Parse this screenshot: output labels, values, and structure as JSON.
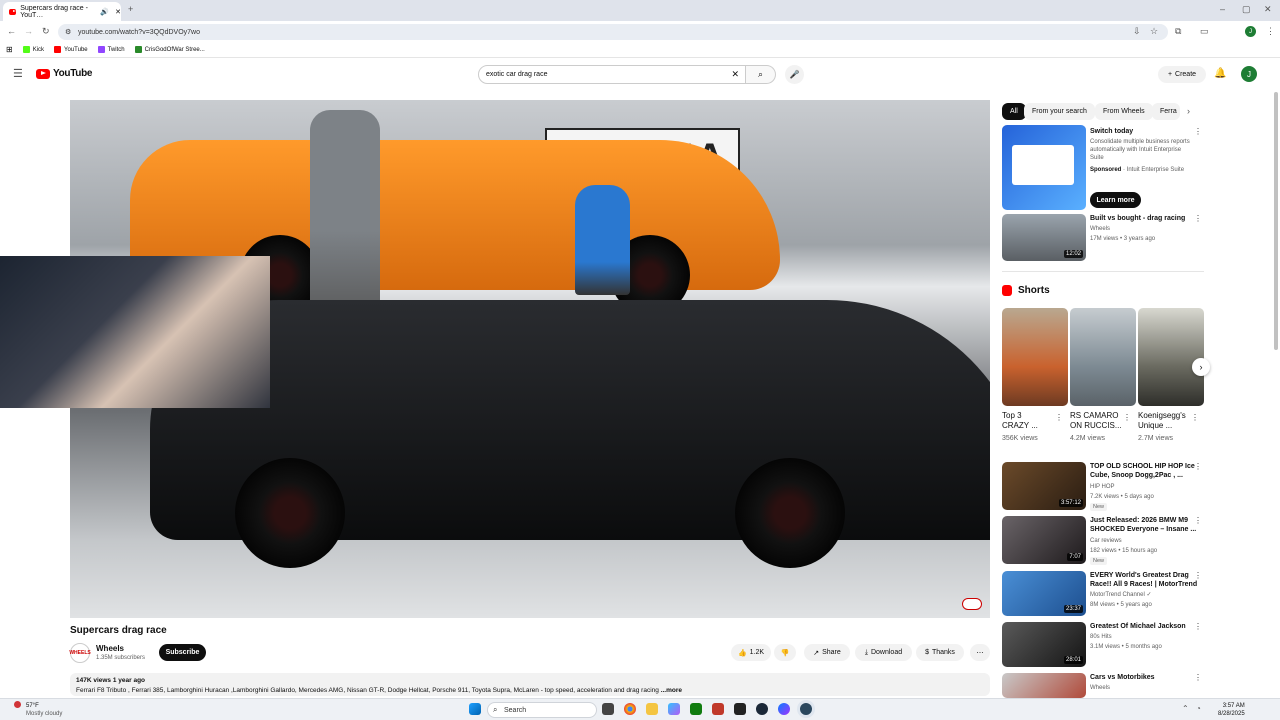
{
  "browser": {
    "tab_title": "Supercars drag race - YouT…",
    "new_tab": "+",
    "url": "youtube.com/watch?v=3QQdDVOy7wo",
    "window_controls": [
      "–",
      "▢",
      "✕"
    ],
    "bookmarks": [
      {
        "label": "Kick",
        "color": "#53fc18"
      },
      {
        "label": "YouTube",
        "color": "#ff0000"
      },
      {
        "label": "Twitch",
        "color": "#9146ff"
      },
      {
        "label": "CrisGodOfWar Stree...",
        "color": "#2a8a2a"
      }
    ],
    "profile_initial": "J"
  },
  "header": {
    "logo_text": "YouTube",
    "search_value": "exotic car drag race",
    "create_label": "Create",
    "avatar_initial": "J"
  },
  "video": {
    "banner_text": "OPTIMA",
    "title": "Supercars drag race",
    "channel": "Wheels",
    "channel_avatar": "WHEELS",
    "subscribers": "1.35M subscribers",
    "subscribe_label": "Subscribe",
    "likes": "1.2K",
    "share_label": "Share",
    "download_label": "Download",
    "thanks_label": "Thanks",
    "views_age": "147K views  1 year ago",
    "description": "Ferrari F8 Tributo , Ferrari 385, Lamborghini Huracan ,Lamborghini Gallardo, Mercedes AMG, Nissan GT-R, Dodge Hellcat, Porsche 911, Toyota Supra, McLaren - top speed, acceleration and drag racing",
    "more_label": "...more"
  },
  "sidebar": {
    "chips": [
      {
        "label": "All",
        "active": true
      },
      {
        "label": "From your search",
        "active": false
      },
      {
        "label": "From Wheels",
        "active": false
      },
      {
        "label": "Ferra",
        "active": false
      }
    ],
    "ad": {
      "title": "Switch today",
      "desc": "Consolidate multiple business reports automatically with Intuit Enterprise Suite",
      "sponsored": "Sponsored",
      "advertiser": "· Intuit Enterprise Suite",
      "cta": "Learn more"
    },
    "rec_top": {
      "title": "Built vs bought - drag racing",
      "channel": "Wheels",
      "meta": "17M views • 3 years ago",
      "duration": "12:02"
    },
    "shorts_heading": "Shorts",
    "shorts": [
      {
        "title1": "Top 3",
        "title2": "CRAZY ...",
        "views": "356K views",
        "color": "#c9622e"
      },
      {
        "title1": "RS CAMARO",
        "title2": "ON RUCCIS...",
        "views": "4.2M views",
        "color": "#7d8a93"
      },
      {
        "title1": "Koenigsegg's",
        "title2": "Unique ...",
        "views": "2.7M views",
        "color": "#6a6a60"
      }
    ],
    "recs": [
      {
        "title1": "TOP OLD SCHOOL HIP HOP Ice",
        "title2": "Cube, Snoop Dogg,2Pac , ...",
        "channel": "HIP HOP",
        "meta": "7.2K views • 5 days ago",
        "badge": "New",
        "duration": "3:57:12",
        "color": "#6b4a2a"
      },
      {
        "title1": "Just Released: 2026 BMW M9",
        "title2": "SHOCKED Everyone – Insane ...",
        "channel": "Car reviews",
        "meta": "182 views • 15 hours ago",
        "badge": "New",
        "duration": "7:07",
        "color": "#3a3438"
      },
      {
        "title1": "EVERY World's Greatest Drag",
        "title2": "Race!! All 9 Races! | MotorTrend",
        "channel": "MotorTrend Channel ✓",
        "meta": "8M views • 5 years ago",
        "badge": "",
        "duration": "23:37",
        "color": "#2f6fb3"
      },
      {
        "title1": "Greatest Of Michael Jackson",
        "title2": "",
        "channel": "80s Hits",
        "meta": "3.1M views • 5 months ago",
        "badge": "",
        "duration": "28:01",
        "color": "#2c2c2c"
      },
      {
        "title1": "Cars vs Motorbikes",
        "title2": "",
        "channel": "Wheels",
        "meta": "",
        "badge": "",
        "duration": "",
        "color": "#b04a3a"
      }
    ]
  },
  "taskbar": {
    "weather_temp": "57°F",
    "weather_desc": "Mostly cloudy",
    "search_placeholder": "Search",
    "time": "3:57 AM",
    "date": "8/28/2025"
  }
}
